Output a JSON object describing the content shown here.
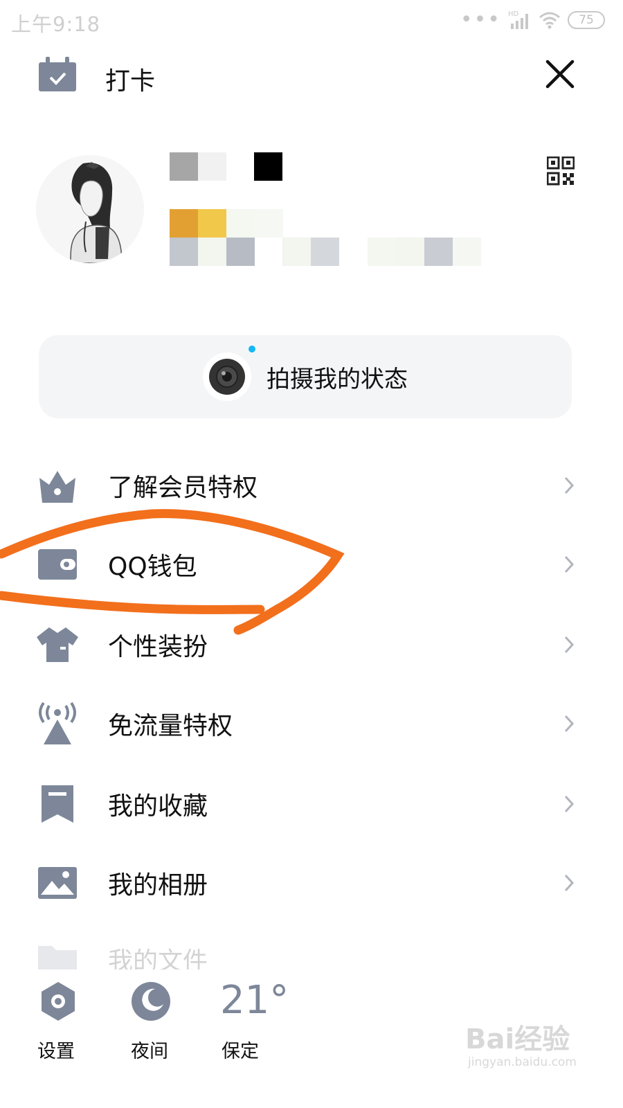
{
  "status_bar": {
    "time": "上午9:18",
    "hd": "HD",
    "battery": "75"
  },
  "header": {
    "checkin_label": "打卡"
  },
  "status_card": {
    "label": "拍摄我的状态"
  },
  "menu": {
    "items": [
      {
        "label": "了解会员特权",
        "icon": "crown-icon"
      },
      {
        "label": "QQ钱包",
        "icon": "wallet-icon"
      },
      {
        "label": "个性装扮",
        "icon": "tshirt-icon"
      },
      {
        "label": "免流量特权",
        "icon": "signal-tower-icon"
      },
      {
        "label": "我的收藏",
        "icon": "bookmark-icon"
      },
      {
        "label": "我的相册",
        "icon": "photo-icon"
      },
      {
        "label": "我的文件",
        "icon": "folder-icon"
      }
    ]
  },
  "bottom_bar": {
    "settings_label": "设置",
    "night_label": "夜间",
    "weather_temp": "21°",
    "weather_city": "保定"
  },
  "watermark": {
    "brand": "Bai经验",
    "url": "jingyan.baidu.com"
  },
  "colors": {
    "icon_gray": "#7d8799",
    "annotation_orange": "#f26f1c",
    "status_dot": "#15b8f2",
    "card_bg": "#f4f5f7"
  }
}
